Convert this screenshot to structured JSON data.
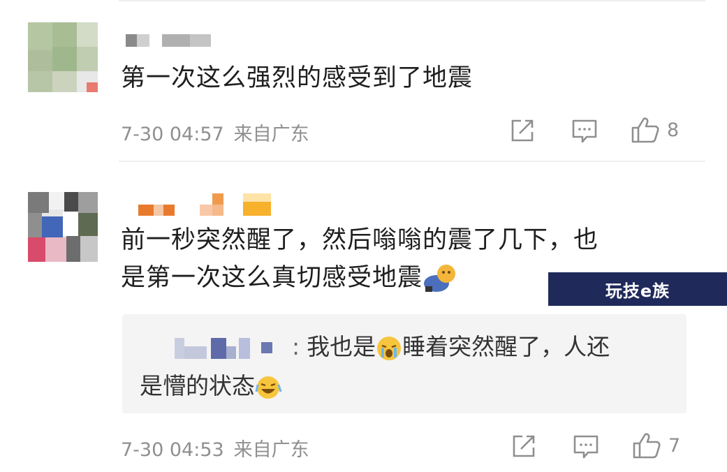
{
  "comments": [
    {
      "text": "第一次这么强烈的感受到了地震",
      "date": "7-30 04:57",
      "location": "来自广东",
      "like_count": "8"
    },
    {
      "text_line1": "前一秒突然醒了，然后嗡嗡的震了几下，也",
      "text_line2": "是第一次这么真切感受地震",
      "reply": {
        "separator": ":",
        "text_part1": "我也是",
        "text_part2": "睡着突然醒了，人还",
        "text_line2": "是懵的状态"
      },
      "date": "7-30 04:53",
      "location": "来自广东",
      "like_count": "7"
    }
  ],
  "watermark": "玩技e族",
  "icons": {
    "repost": "share-box-icon",
    "comment": "comment-icon",
    "like": "thumbs-up-icon",
    "emoji_hug": "hug-emoji-icon",
    "emoji_cry": "crying-emoji-icon",
    "emoji_laugh": "laughing-emoji-icon"
  }
}
